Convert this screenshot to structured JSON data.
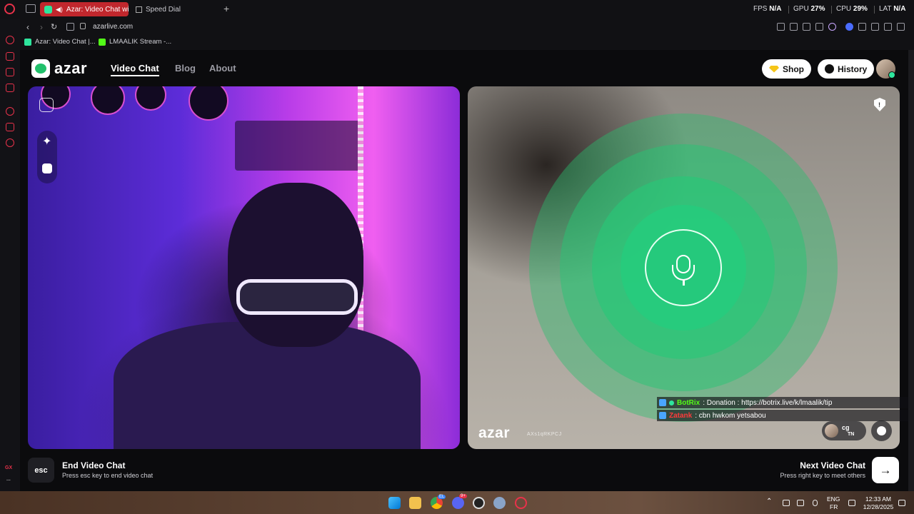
{
  "browser": {
    "tabs": [
      {
        "label": "Azar: Video Chat with",
        "active": true
      },
      {
        "label": "Speed Dial",
        "active": false
      }
    ],
    "new_tab_label": "+",
    "perf": {
      "fps_label": "FPS",
      "fps_value": "N/A",
      "gpu_label": "GPU",
      "gpu_value": "27",
      "cpu_label": "CPU",
      "cpu_value": "29",
      "lat_label": "LAT",
      "lat_value": "N/A",
      "percent": "%"
    },
    "url": "azarlive.com",
    "bookmarks": [
      {
        "label": "Azar: Video Chat |...",
        "color": "#2ee59d"
      },
      {
        "label": "LMAALIK Stream -...",
        "color": "#53fc18"
      }
    ],
    "sidebar_footer": "GX",
    "sidebar_more": "..."
  },
  "site": {
    "logo_text": "azar",
    "nav": [
      {
        "label": "Video Chat",
        "active": true
      },
      {
        "label": "Blog",
        "active": false
      },
      {
        "label": "About",
        "active": false
      }
    ],
    "shop_label": "Shop",
    "history_label": "History"
  },
  "right_video": {
    "watermark": "azar",
    "session_id": "AXs1qRKPCJ",
    "peer_name": "cg",
    "peer_country": "TN"
  },
  "stream_overlay": [
    {
      "user": "BotRix",
      "user_color": "#53fc18",
      "message": ": Donation : https://botrix.live/k/lmaalik/tip"
    },
    {
      "user": "Zatank",
      "user_color": "#ff3b3b",
      "message": ": cbn hwkom yetsabou"
    }
  ],
  "controls": {
    "esc_key": "esc",
    "end_title": "End Video Chat",
    "end_sub": "Press esc key to end video chat",
    "next_title": "Next Video Chat",
    "next_sub": "Press right key to meet others",
    "next_arrow": "→"
  },
  "taskbar": {
    "lang_top": "ENG",
    "lang_bottom": "FR",
    "time": "12:33 AM",
    "date": "12/28/2025",
    "chrome_badge": "EL",
    "discord_badge": "9+"
  },
  "colors": {
    "accent_green": "#25c97c",
    "tab_red": "#c1272d",
    "gx_red": "#e8324a"
  }
}
